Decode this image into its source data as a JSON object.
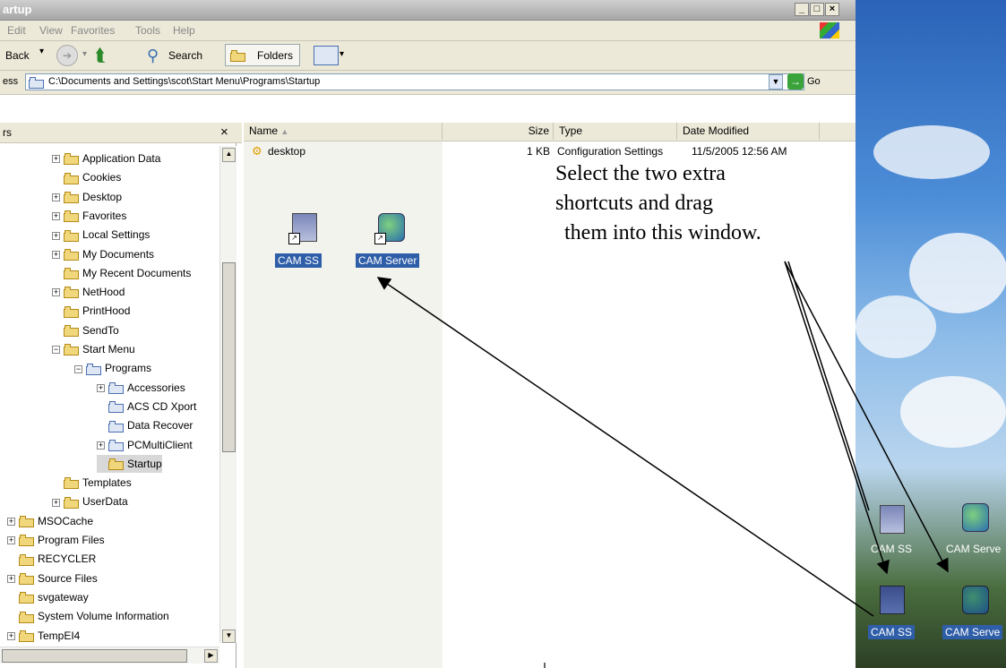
{
  "window": {
    "title": "artup"
  },
  "menu": [
    "Edit",
    "View",
    "Favorites",
    "Tools",
    "Help"
  ],
  "toolbar": {
    "back": "Back",
    "search": "Search",
    "folders": "Folders"
  },
  "address": {
    "label": "ess",
    "path": "C:\\Documents and Settings\\scot\\Start Menu\\Programs\\Startup",
    "go": "Go"
  },
  "pane": {
    "title": "rs",
    "close": "×"
  },
  "tree": [
    {
      "label": "Application Data",
      "expand": "+",
      "depth": 3
    },
    {
      "label": "Cookies",
      "expand": "",
      "depth": 3
    },
    {
      "label": "Desktop",
      "expand": "+",
      "depth": 3
    },
    {
      "label": "Favorites",
      "expand": "+",
      "depth": 3
    },
    {
      "label": "Local Settings",
      "expand": "+",
      "depth": 3
    },
    {
      "label": "My Documents",
      "expand": "+",
      "depth": 3
    },
    {
      "label": "My Recent Documents",
      "expand": "",
      "depth": 3
    },
    {
      "label": "NetHood",
      "expand": "+",
      "depth": 3
    },
    {
      "label": "PrintHood",
      "expand": "",
      "depth": 3
    },
    {
      "label": "SendTo",
      "expand": "",
      "depth": 3
    },
    {
      "label": "Start Menu",
      "expand": "−",
      "depth": 3
    },
    {
      "label": "Programs",
      "expand": "−",
      "depth": 4
    },
    {
      "label": "Accessories",
      "expand": "+",
      "depth": 5
    },
    {
      "label": "ACS CD Xport",
      "expand": "",
      "depth": 5
    },
    {
      "label": "Data Recover",
      "expand": "",
      "depth": 5
    },
    {
      "label": "PCMultiClient",
      "expand": "+",
      "depth": 5
    },
    {
      "label": "Startup",
      "expand": "",
      "depth": 5
    },
    {
      "label": "Templates",
      "expand": "",
      "depth": 3
    },
    {
      "label": "UserData",
      "expand": "+",
      "depth": 3
    },
    {
      "label": "MSOCache",
      "expand": "+",
      "depth": 1
    },
    {
      "label": "Program Files",
      "expand": "+",
      "depth": 1
    },
    {
      "label": "RECYCLER",
      "expand": "",
      "depth": 1
    },
    {
      "label": "Source Files",
      "expand": "+",
      "depth": 1
    },
    {
      "label": "svgateway",
      "expand": "",
      "depth": 1
    },
    {
      "label": "System Volume Information",
      "expand": "",
      "depth": 1
    },
    {
      "label": "TempEI4",
      "expand": "+",
      "depth": 1
    }
  ],
  "columns": {
    "name": "Name",
    "size": "Size",
    "type": "Type",
    "date": "Date Modified"
  },
  "file": {
    "name": "desktop",
    "size": "1 KB",
    "type": "Configuration Settings",
    "date": "11/5/2005 12:56 AM"
  },
  "window_icons": {
    "cam_ss": "CAM SS",
    "cam_server": "CAM Server"
  },
  "instruction": [
    "Select the two extra",
    "shortcuts and drag",
    "them into this window."
  ],
  "desktop_icons": {
    "cam_ss_top": "CAM SS",
    "cam_server_top": "CAM Serve",
    "cam_ss_bottom": "CAM SS",
    "cam_server_bottom": "CAM Serve"
  }
}
